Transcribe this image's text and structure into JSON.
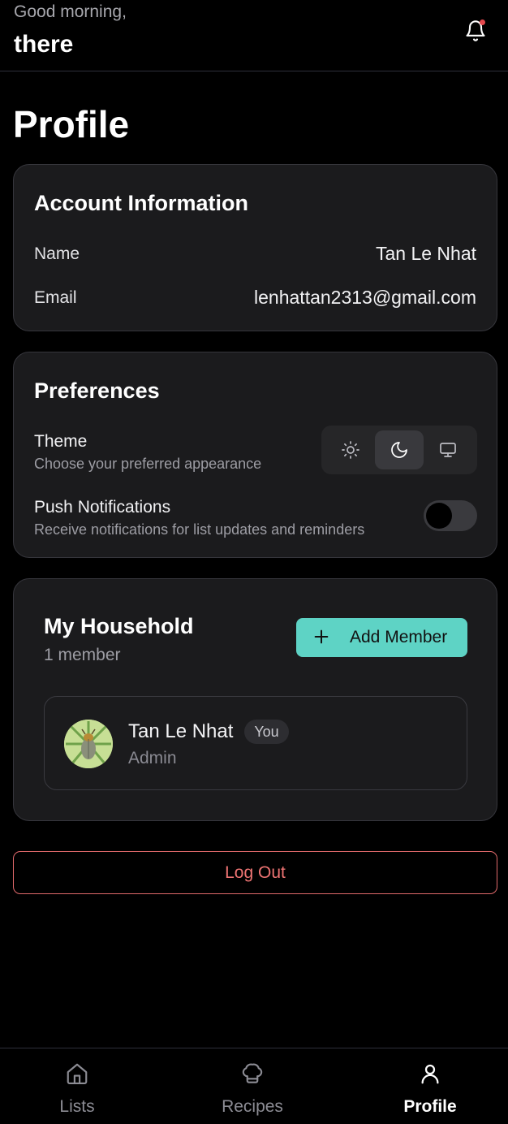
{
  "header": {
    "greeting": "Good morning,",
    "username": "there",
    "notification_icon": "bell-icon",
    "has_unread": true,
    "unread_color": "#e5484d"
  },
  "page": {
    "title": "Profile"
  },
  "account": {
    "title": "Account Information",
    "name_label": "Name",
    "name_value": "Tan Le Nhat",
    "email_label": "Email",
    "email_value": "lenhattan2313@gmail.com"
  },
  "preferences": {
    "title": "Preferences",
    "theme_label": "Theme",
    "theme_sub": "Choose your preferred appearance",
    "theme_options": [
      {
        "icon": "sun-icon",
        "value": "light",
        "active": false
      },
      {
        "icon": "moon-icon",
        "value": "dark",
        "active": true
      },
      {
        "icon": "monitor-icon",
        "value": "system",
        "active": false
      }
    ],
    "push_label": "Push Notifications",
    "push_sub": "Receive notifications for list updates and reminders",
    "push_enabled": false
  },
  "household": {
    "title": "My Household",
    "count": "1 member",
    "add_label": "Add Member",
    "accent": "#5ed3c5",
    "members": [
      {
        "name": "Tan Le Nhat",
        "badge": "You",
        "role": "Admin",
        "avatar": "beetle-avatar"
      }
    ]
  },
  "logout": {
    "label": "Log Out",
    "color": "#ee7473"
  },
  "tabs": [
    {
      "label": "Lists",
      "icon": "home-icon",
      "active": false
    },
    {
      "label": "Recipes",
      "icon": "chef-hat-icon",
      "active": false
    },
    {
      "label": "Profile",
      "icon": "user-icon",
      "active": true
    }
  ]
}
